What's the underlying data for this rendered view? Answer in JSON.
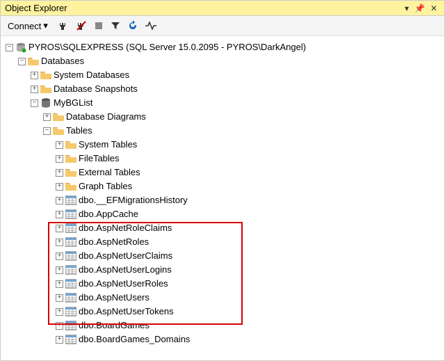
{
  "title": "Object Explorer",
  "toolbar": {
    "connect": "Connect"
  },
  "tree": {
    "server": "PYROS\\SQLEXPRESS (SQL Server 15.0.2095 - PYROS\\DarkAngel)",
    "databases": "Databases",
    "sysdb": "System Databases",
    "snapshots": "Database Snapshots",
    "mybglist": "MyBGList",
    "diagrams": "Database Diagrams",
    "tables": "Tables",
    "systables": "System Tables",
    "filetables": "FileTables",
    "exttables": "External Tables",
    "graphtables": "Graph Tables",
    "t_efmig": "dbo.__EFMigrationsHistory",
    "t_appcache": "dbo.AppCache",
    "t_roleclaims": "dbo.AspNetRoleClaims",
    "t_roles": "dbo.AspNetRoles",
    "t_userclaims": "dbo.AspNetUserClaims",
    "t_userlogins": "dbo.AspNetUserLogins",
    "t_userroles": "dbo.AspNetUserRoles",
    "t_users": "dbo.AspNetUsers",
    "t_usertokens": "dbo.AspNetUserTokens",
    "t_boardgames": "dbo.BoardGames",
    "t_bgdomains": "dbo.BoardGames_Domains"
  }
}
